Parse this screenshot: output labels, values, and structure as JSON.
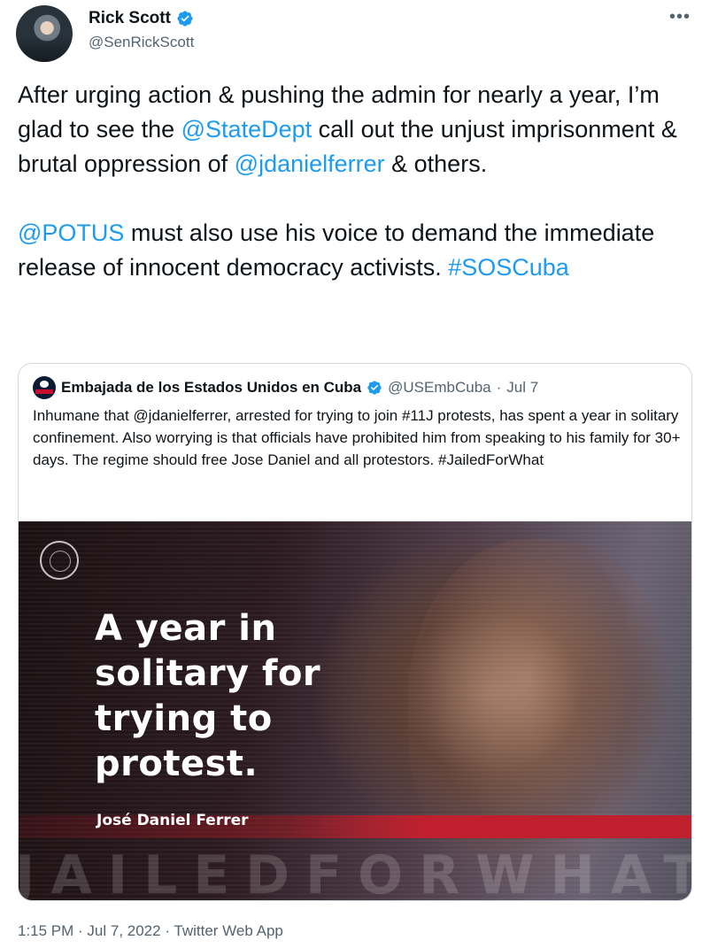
{
  "author": {
    "name": "Rick Scott",
    "handle": "@SenRickScott"
  },
  "more_icon": "more-dots-icon",
  "tweet": {
    "p1": [
      {
        "text": "After urging action & pushing the admin for nearly a year, I’m glad to see the ",
        "link": false
      },
      {
        "text": "@StateDept",
        "link": true
      },
      {
        "text": " call out the unjust imprisonment & brutal oppression of ",
        "link": false
      },
      {
        "text": "@jdanielferrer",
        "link": true
      },
      {
        "text": " & others.",
        "link": false
      }
    ],
    "p2": [
      {
        "text": "@POTUS",
        "link": true
      },
      {
        "text": " must also use his voice to demand the immediate release of innocent democracy activists. ",
        "link": false
      },
      {
        "text": "#SOSCuba",
        "link": true
      }
    ]
  },
  "quote": {
    "name": "Embajada de los Estados Unidos en Cuba",
    "handle": "@USEmbCuba",
    "sep": "·",
    "date": "Jul 7",
    "text": "Inhumane that @jdanielferrer, arrested for trying to join #11J protests, has spent a year in solitary confinement. Also worrying is that officials have prohibited him from speaking to his family for 30+ days. The regime should free Jose Daniel and all protestors. #JailedForWhat",
    "image": {
      "headline_lines": [
        "A year in",
        "solitary for",
        "trying to",
        "protest."
      ],
      "caption": "José Daniel Ferrer",
      "watermark": "JAILEDFORWHAT"
    }
  },
  "meta": "1:15 PM · Jul 7, 2022 · Twitter Web App",
  "colors": {
    "link": "#1d9bf0",
    "verified": "#1d9bf0",
    "secondary_text": "#536471",
    "red_bar": "#c0202e"
  }
}
